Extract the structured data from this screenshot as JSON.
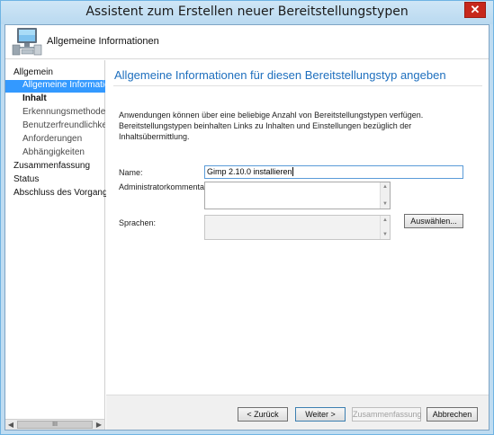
{
  "window": {
    "title": "Assistent zum Erstellen neuer Bereitstellungstypen",
    "close_glyph": "✕"
  },
  "header": {
    "title": "Allgemeine Informationen",
    "icon": "computer-icon"
  },
  "nav": {
    "items": [
      {
        "label": "Allgemein",
        "level": "top",
        "state": "normal"
      },
      {
        "label": "Allgemeine Informatione",
        "level": "sub",
        "state": "active"
      },
      {
        "label": "Inhalt",
        "level": "sub",
        "state": "bold"
      },
      {
        "label": "Erkennungsmethode",
        "level": "sub",
        "state": "normal"
      },
      {
        "label": "Benutzerfreundlichkeit",
        "level": "sub",
        "state": "normal"
      },
      {
        "label": "Anforderungen",
        "level": "sub",
        "state": "normal"
      },
      {
        "label": "Abhängigkeiten",
        "level": "sub",
        "state": "normal"
      },
      {
        "label": "Zusammenfassung",
        "level": "top",
        "state": "normal"
      },
      {
        "label": "Status",
        "level": "top",
        "state": "normal"
      },
      {
        "label": "Abschluss des Vorgangs",
        "level": "top",
        "state": "normal"
      }
    ],
    "scroll_thumb_glyph": "III"
  },
  "main": {
    "title": "Allgemeine Informationen für diesen Bereitstellungstyp angeben",
    "description": "Anwendungen können über eine beliebige Anzahl von Bereitstellungstypen verfügen. Bereitstellungstypen beinhalten Links zu Inhalten und Einstellungen bezüglich der Inhaltsübermittlung.",
    "name_label": "Name:",
    "name_value": "Gimp 2.10.0 installieren",
    "admin_label": "Administratorkommentare:",
    "languages_label": "Sprachen:",
    "select_button": "Auswählen..."
  },
  "footer": {
    "back": "< Zurück",
    "next": "Weiter >",
    "summary": "Zusammenfassung",
    "cancel": "Abbrechen"
  },
  "colors": {
    "accent": "#3399ff",
    "title": "#1e6fbe",
    "close": "#c7281c"
  }
}
